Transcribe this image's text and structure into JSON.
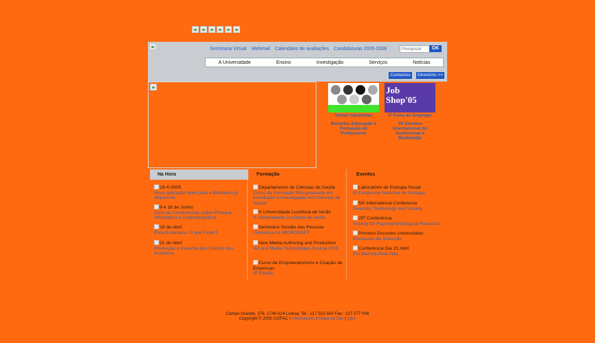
{
  "header": {
    "top_links": [
      "Secretaria Virtual",
      "Webmail",
      "Calendário de avaliações",
      "Candidaturas 2005-2006"
    ],
    "search_placeholder": "Pesquisar",
    "ok_label": "OK",
    "nav": [
      "A Universidade",
      "Ensino",
      "Investigação",
      "Serviços",
      "Notícias"
    ],
    "contactos_label": "Contactos",
    "directorio_label": "Directório >>"
  },
  "promos": [
    {
      "title": "Temas Candentes",
      "text": "Bolonha, Educação e Formação de Professores"
    },
    {
      "title": "5ª Feira do Emprego",
      "text": "VII Semana Internacional do Audiovisual e Multimédia",
      "image_text": [
        "Job",
        "Shop'05"
      ]
    }
  ],
  "columns": {
    "hora": {
      "heading": "Na Hora",
      "items": [
        {
          "title": "19-4-2005",
          "text": "Nova aplicação Web para a Biblioteca já disponível"
        },
        {
          "title": "9 e 16 de Junho",
          "text": "Ciclo de Conferências sobre Pirataria Informática e Cinematográfica"
        },
        {
          "title": "19 de Abril",
          "text": "Ética Eutanásia: O que Fazer?"
        },
        {
          "title": "21 de Abril",
          "text": "Promoção e Garantia dos Direitos dos Humanos"
        }
      ]
    },
    "formacao": {
      "heading": "Formação",
      "items": [
        {
          "title": "Departamento de Ciências da Saúde",
          "text": "Curso de Formação Pós-graduada em Introdução à Investigação em Ciências da Saúde"
        },
        {
          "title": "X Universidade Lusófona de Verão",
          "text": "X Universidade Lusófona de Verão"
        },
        {
          "title": "Seminário Gestão das Pessoas",
          "text": "Liderança na MICROSOFT"
        },
        {
          "title": "New Media Authoring and Production",
          "text": "Art and Media Technologies Course 2005"
        },
        {
          "title": "Curso de Empreendorismo e Criação de Empresas",
          "text": "3ª Edição"
        }
      ]
    },
    "eventos": {
      "heading": "Eventos",
      "items": [
        {
          "title": "Laboratório de Etologia Social",
          "text": "III Congresso Nacional de Etologia"
        },
        {
          "title": "5th International Conference",
          "text": "Diversity, Technology and Society"
        },
        {
          "title": "25ª Conferência",
          "text": "Society for Psychophysiological Research"
        },
        {
          "title": "Primeiro Encontro Universitário",
          "text": "Processos de Selecção"
        },
        {
          "title": "Conferência Dia 21 Abril",
          "text": "Em Marcha Pela Vida"
        }
      ]
    }
  },
  "footer": {
    "address": "Campo Grande, 376, 1749-024 Lisboa, Tel.: 217 515 500 Fax.: 217 577 006",
    "copyright": "Copyright © 2005 COFAC |",
    "links": [
      "Informações",
      "Mapa do Site",
      "Q&A"
    ]
  },
  "colors": {
    "background": "#ff6a10",
    "header_bg": "#c9cdd2",
    "link_blue": "#2a5fb5",
    "button_blue": "#1f57c4"
  }
}
